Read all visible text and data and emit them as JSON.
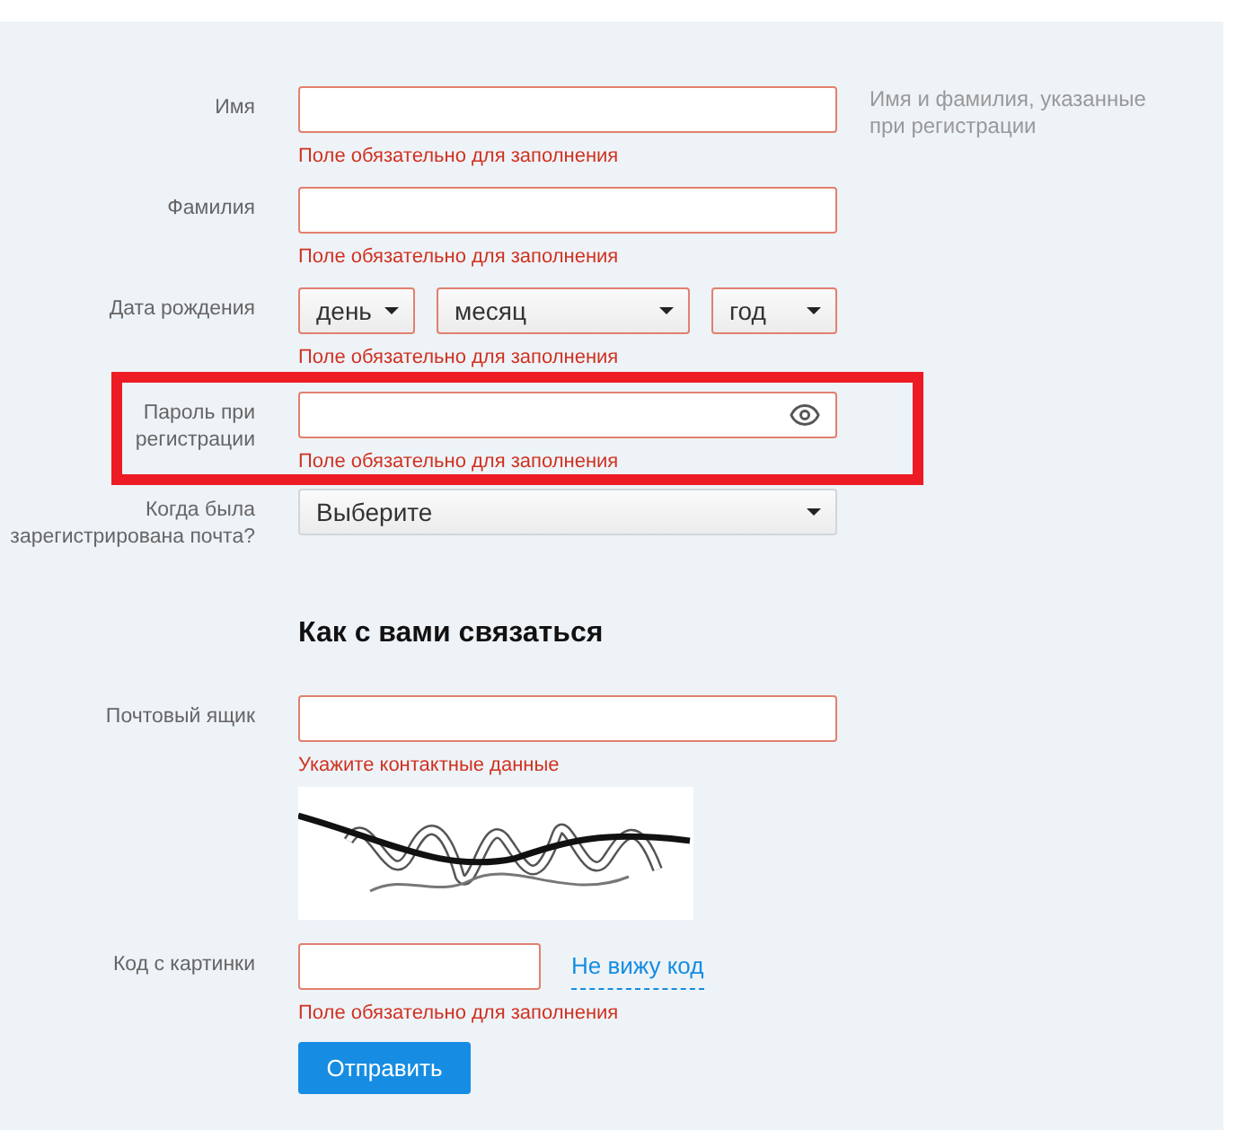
{
  "fields": [
    {
      "kind": "text",
      "label": "Имя",
      "error": "Поле обязательно для заполнения",
      "invalid": true,
      "highlighted": false,
      "hint": "Имя и фамилия, указанные\nпри регистрации"
    },
    {
      "kind": "text",
      "label": "Фамилия",
      "error": "Поле обязательно для заполнения",
      "invalid": true,
      "highlighted": false
    },
    {
      "kind": "date",
      "label": "Дата рождения",
      "error": "Поле обязательно для заполнения",
      "invalid": true,
      "highlighted": false,
      "selects": [
        "день",
        "месяц",
        "год"
      ]
    },
    {
      "kind": "password",
      "label": "Пароль при\nрегистрации",
      "error": "Поле обязательно для заполнения",
      "invalid": true,
      "highlighted": true
    },
    {
      "kind": "select",
      "label": "Когда была\nзарегистрирована почта?",
      "value": "Выберите",
      "invalid": false,
      "highlighted": false
    }
  ],
  "contact": {
    "heading": "Как с вами связаться",
    "fields": [
      {
        "kind": "text",
        "label": "Почтовый ящик",
        "error": "Укажите контактные данные",
        "invalid": true,
        "highlighted": false
      },
      {
        "kind": "captcha",
        "label": "Код с картинки",
        "error": "Поле обязательно для заполнения",
        "invalid": true,
        "highlighted": false,
        "link": "Не вижу код"
      }
    ]
  },
  "submit": "Отправить"
}
